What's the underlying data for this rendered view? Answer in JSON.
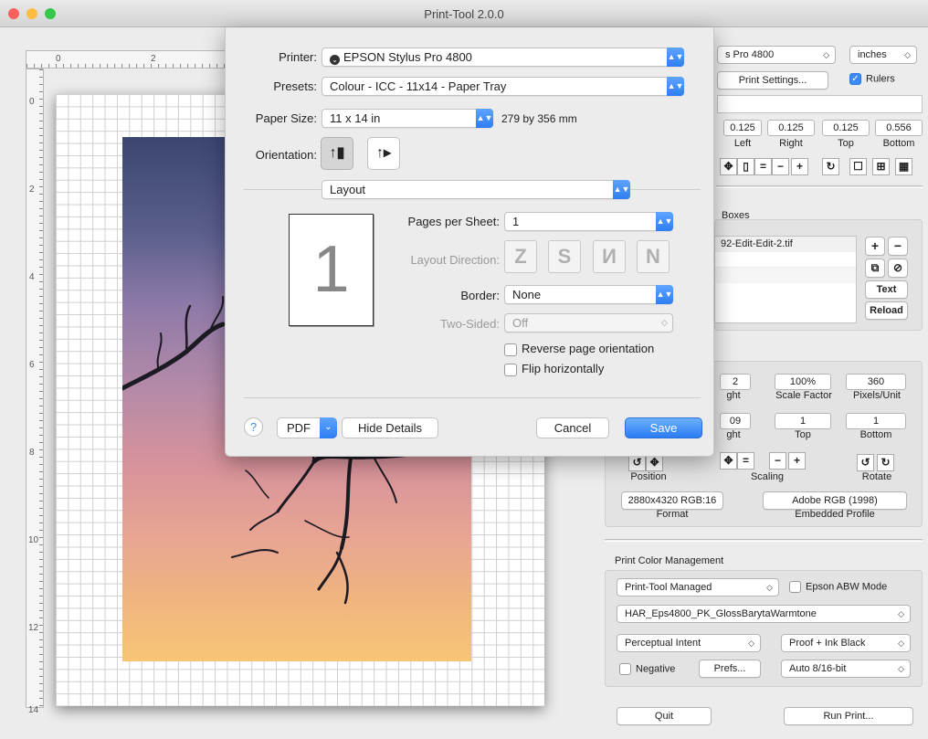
{
  "window": {
    "title": "Print-Tool 2.0.0"
  },
  "rulers": {
    "h_labels": [
      "0",
      "2"
    ],
    "v_labels": [
      "0",
      "2",
      "4",
      "6",
      "8",
      "10",
      "12",
      "14"
    ]
  },
  "right_panel": {
    "printer_value": "s Pro 4800",
    "units_value": "inches",
    "print_settings_label": "Print Settings...",
    "rulers_label": "Rulers",
    "margins": [
      {
        "value": "0.125",
        "label": "Left"
      },
      {
        "value": "0.125",
        "label": "Right"
      },
      {
        "value": "0.125",
        "label": "Top"
      },
      {
        "value": "0.556",
        "label": "Bottom"
      }
    ],
    "boxes_title": "Boxes",
    "box_file": "92-Edit-Edit-2.tif",
    "text_label": "Text",
    "reload_label": "Reload",
    "image": {
      "width_value": "2",
      "width_label": "ght",
      "scale_value": "100%",
      "scale_label": "Scale Factor",
      "ppu_value": "360",
      "ppu_label": "Pixels/Unit",
      "height_value": "09",
      "height_label": "ght",
      "top_value": "1",
      "top_label": "Top",
      "bottom_value": "1",
      "bottom_label": "Bottom",
      "position_label": "Position",
      "scaling_label": "Scaling",
      "rotate_label": "Rotate",
      "format_value": "2880x4320 RGB:16",
      "format_label": "Format",
      "profile_value": "Adobe RGB (1998)",
      "profile_label": "Embedded Profile"
    },
    "color_mgmt": {
      "title": "Print Color Management",
      "managed": "Print-Tool Managed",
      "abw_label": "Epson ABW Mode",
      "profile": "HAR_Eps4800_PK_GlossBarytaWarmtone",
      "intent": "Perceptual Intent",
      "proof": "Proof + Ink Black",
      "negative_label": "Negative",
      "prefs_label": "Prefs...",
      "bit": "Auto 8/16-bit"
    },
    "quit_label": "Quit",
    "run_label": "Run Print..."
  },
  "dialog": {
    "printer_label": "Printer:",
    "printer_value": "EPSON Stylus Pro 4800",
    "presets_label": "Presets:",
    "presets_value": "Colour - ICC - 11x14 - Paper Tray",
    "paper_label": "Paper Size:",
    "paper_value": "11 x 14 in",
    "paper_mm": "279 by 356 mm",
    "orientation_label": "Orientation:",
    "section_value": "Layout",
    "preview_number": "1",
    "pages_label": "Pages per Sheet:",
    "pages_value": "1",
    "direction_label": "Layout Direction:",
    "border_label": "Border:",
    "border_value": "None",
    "twosided_label": "Two-Sided:",
    "twosided_value": "Off",
    "reverse_label": "Reverse page orientation",
    "flip_label": "Flip horizontally",
    "help_label": "?",
    "pdf_label": "PDF",
    "hide_label": "Hide Details",
    "cancel_label": "Cancel",
    "save_label": "Save"
  },
  "colors": {
    "accent": "#3b8bf6",
    "close": "#fc605c",
    "minimize": "#fdbc40",
    "zoom": "#34c84a"
  }
}
